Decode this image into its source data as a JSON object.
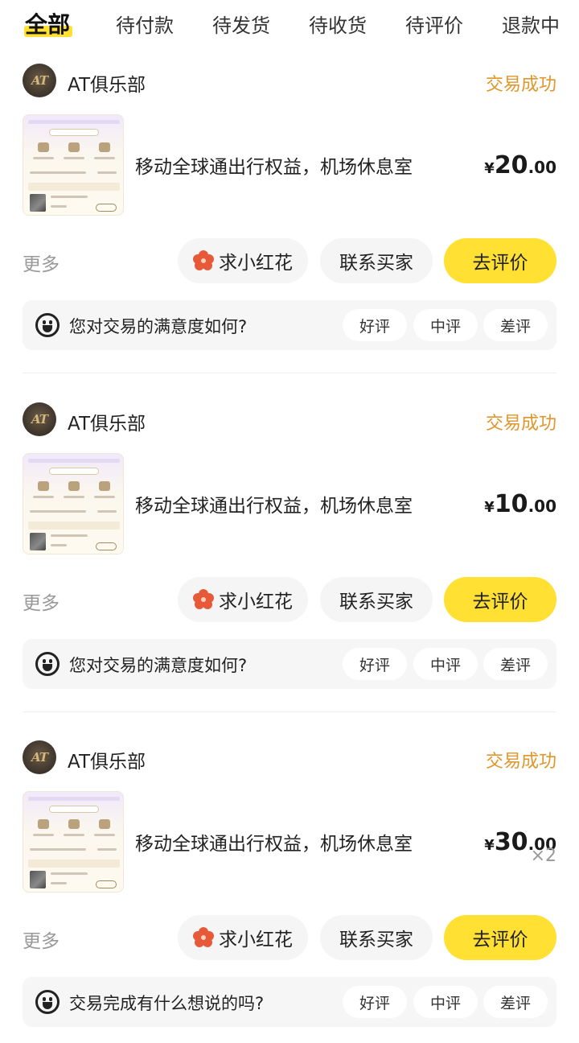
{
  "tabs": [
    {
      "label": "全部",
      "active": true
    },
    {
      "label": "待付款"
    },
    {
      "label": "待发货"
    },
    {
      "label": "待收货"
    },
    {
      "label": "待评价"
    },
    {
      "label": "退款中"
    }
  ],
  "colors": {
    "accent_yellow": "#ffe033",
    "status_orange": "#e0962a",
    "muted": "#999999"
  },
  "orders": [
    {
      "shop": {
        "avatar_text": "AT",
        "name": "AT俱乐部"
      },
      "status": "交易成功",
      "product": {
        "title": "移动全球通出行权益，机场休息室",
        "currency": "¥",
        "price_int": "20",
        "price_dec": ".00",
        "quantity": ""
      },
      "actions": {
        "more": "更多",
        "flower": "求小红花",
        "contact": "联系买家",
        "review": "去评价"
      },
      "survey": {
        "question": "您对交易的满意度如何?",
        "good": "好评",
        "mid": "中评",
        "bad": "差评"
      }
    },
    {
      "shop": {
        "avatar_text": "AT",
        "name": "AT俱乐部"
      },
      "status": "交易成功",
      "product": {
        "title": "移动全球通出行权益，机场休息室",
        "currency": "¥",
        "price_int": "10",
        "price_dec": ".00",
        "quantity": ""
      },
      "actions": {
        "more": "更多",
        "flower": "求小红花",
        "contact": "联系买家",
        "review": "去评价"
      },
      "survey": {
        "question": "您对交易的满意度如何?",
        "good": "好评",
        "mid": "中评",
        "bad": "差评"
      }
    },
    {
      "shop": {
        "avatar_text": "AT",
        "name": "AT俱乐部"
      },
      "status": "交易成功",
      "product": {
        "title": "移动全球通出行权益，机场休息室",
        "currency": "¥",
        "price_int": "30",
        "price_dec": ".00",
        "quantity": "×2"
      },
      "actions": {
        "more": "更多",
        "flower": "求小红花",
        "contact": "联系买家",
        "review": "去评价"
      },
      "survey": {
        "question": "交易完成有什么想说的吗?",
        "good": "好评",
        "mid": "中评",
        "bad": "差评"
      }
    }
  ]
}
